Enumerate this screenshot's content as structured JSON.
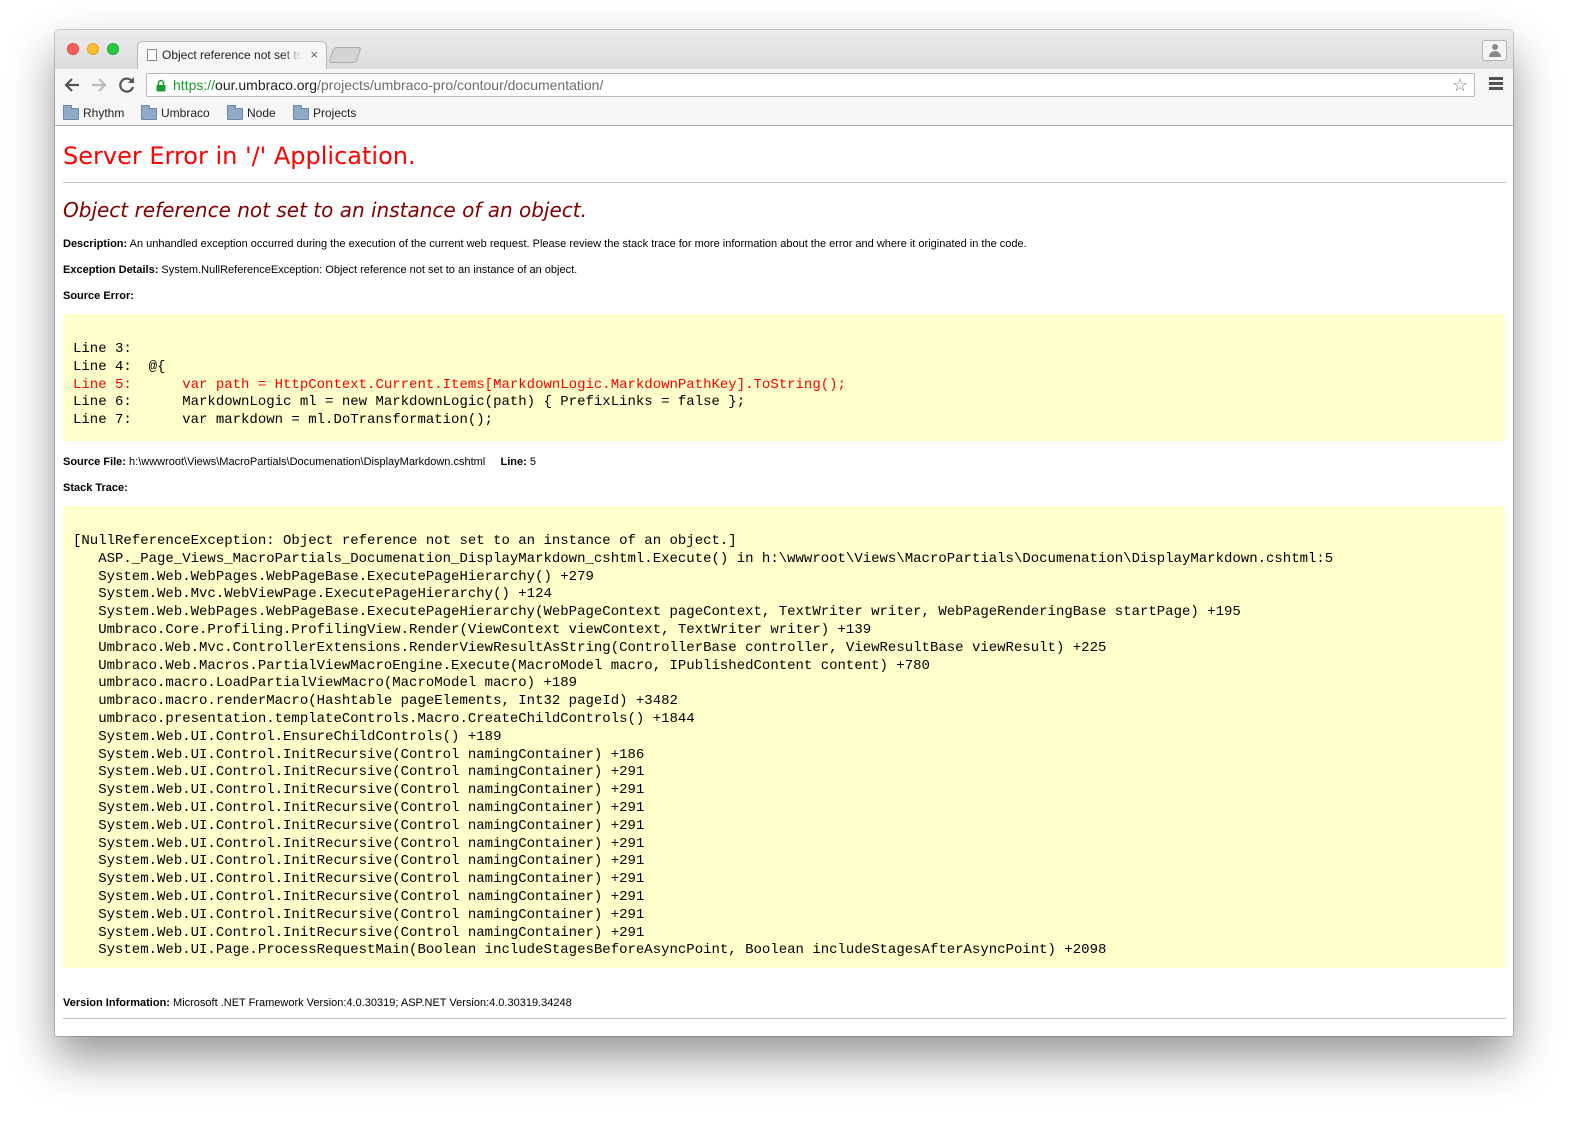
{
  "browser": {
    "tab_title": "Object reference not set to an instance of an object.",
    "url_scheme": "https://",
    "url_host": "our.umbraco.org",
    "url_path": "/projects/umbraco-pro/contour/documentation/",
    "bookmarks": [
      "Rhythm",
      "Umbraco",
      "Node",
      "Projects"
    ],
    "close_glyph": "×",
    "star_glyph": "☆"
  },
  "page": {
    "heading": "Server Error in '/' Application.",
    "error_title": "Object reference not set to an instance of an object.",
    "description_label": "Description:",
    "description_text": "An unhandled exception occurred during the execution of the current web request. Please review the stack trace for more information about the error and where it originated in the code.",
    "exception_label": "Exception Details:",
    "exception_text": "System.NullReferenceException: Object reference not set to an instance of an object.",
    "source_error_label": "Source Error:",
    "source_lines": [
      {
        "text": "Line 3:  ",
        "highlight": false
      },
      {
        "text": "Line 4:  @{",
        "highlight": false
      },
      {
        "text": "Line 5:      var path = HttpContext.Current.Items[MarkdownLogic.MarkdownPathKey].ToString();",
        "highlight": true
      },
      {
        "text": "Line 6:      MarkdownLogic ml = new MarkdownLogic(path) { PrefixLinks = false };",
        "highlight": false
      },
      {
        "text": "Line 7:      var markdown = ml.DoTransformation();",
        "highlight": false
      }
    ],
    "source_file_label": "Source File:",
    "source_file": "h:\\wwwroot\\Views\\MacroPartials\\Documenation\\DisplayMarkdown.cshtml",
    "line_label": "Line:",
    "line_value": "5",
    "stack_trace_label": "Stack Trace:",
    "stack_trace": [
      "[NullReferenceException: Object reference not set to an instance of an object.]",
      "   ASP._Page_Views_MacroPartials_Documenation_DisplayMarkdown_cshtml.Execute() in h:\\wwwroot\\Views\\MacroPartials\\Documenation\\DisplayMarkdown.cshtml:5",
      "   System.Web.WebPages.WebPageBase.ExecutePageHierarchy() +279",
      "   System.Web.Mvc.WebViewPage.ExecutePageHierarchy() +124",
      "   System.Web.WebPages.WebPageBase.ExecutePageHierarchy(WebPageContext pageContext, TextWriter writer, WebPageRenderingBase startPage) +195",
      "   Umbraco.Core.Profiling.ProfilingView.Render(ViewContext viewContext, TextWriter writer) +139",
      "   Umbraco.Web.Mvc.ControllerExtensions.RenderViewResultAsString(ControllerBase controller, ViewResultBase viewResult) +225",
      "   Umbraco.Web.Macros.PartialViewMacroEngine.Execute(MacroModel macro, IPublishedContent content) +780",
      "   umbraco.macro.LoadPartialViewMacro(MacroModel macro) +189",
      "   umbraco.macro.renderMacro(Hashtable pageElements, Int32 pageId) +3482",
      "   umbraco.presentation.templateControls.Macro.CreateChildControls() +1844",
      "   System.Web.UI.Control.EnsureChildControls() +189",
      "   System.Web.UI.Control.InitRecursive(Control namingContainer) +186",
      "   System.Web.UI.Control.InitRecursive(Control namingContainer) +291",
      "   System.Web.UI.Control.InitRecursive(Control namingContainer) +291",
      "   System.Web.UI.Control.InitRecursive(Control namingContainer) +291",
      "   System.Web.UI.Control.InitRecursive(Control namingContainer) +291",
      "   System.Web.UI.Control.InitRecursive(Control namingContainer) +291",
      "   System.Web.UI.Control.InitRecursive(Control namingContainer) +291",
      "   System.Web.UI.Control.InitRecursive(Control namingContainer) +291",
      "   System.Web.UI.Control.InitRecursive(Control namingContainer) +291",
      "   System.Web.UI.Control.InitRecursive(Control namingContainer) +291",
      "   System.Web.UI.Control.InitRecursive(Control namingContainer) +291",
      "   System.Web.UI.Page.ProcessRequestMain(Boolean includeStagesBeforeAsyncPoint, Boolean includeStagesAfterAsyncPoint) +2098"
    ],
    "version_label": "Version Information:",
    "version_text": "Microsoft .NET Framework Version:4.0.30319; ASP.NET Version:4.0.30319.34248"
  },
  "colors": {
    "heading": "#ff0000",
    "error_title": "#800000",
    "code_background": "#ffffcc",
    "highlight_line": "#ff0000",
    "url_scheme": "#1a9a2c"
  }
}
